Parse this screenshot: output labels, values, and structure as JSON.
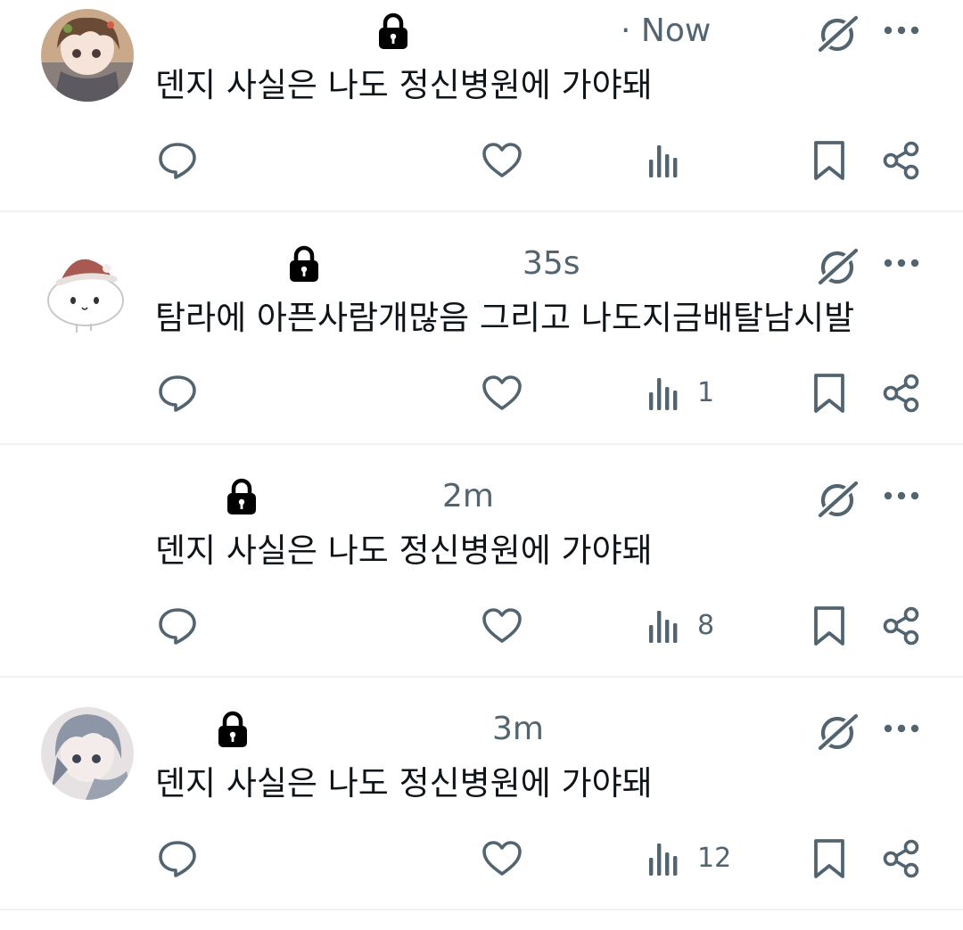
{
  "colors": {
    "text": "#0f1419",
    "secondary": "#536471",
    "divider": "#eff3f4"
  },
  "tweets": [
    {
      "has_avatar": true,
      "avatar_style": "brown-hair",
      "timestamp": "· Now",
      "text": "덴지 사실은 나도 정신병원에 가야돼",
      "view_count": ""
    },
    {
      "has_avatar": true,
      "avatar_style": "white-blob-santa-hat",
      "timestamp": "35s",
      "text": "탐라에 아픈사람개많음 그리고 나도지금배탈남시발",
      "view_count": "1"
    },
    {
      "has_avatar": false,
      "timestamp": "2m",
      "text": "덴지 사실은 나도 정신병원에 가야돼",
      "view_count": "8"
    },
    {
      "has_avatar": true,
      "avatar_style": "grey-hair",
      "timestamp": "3m",
      "text": "덴지 사실은 나도 정신병원에 가야돼",
      "view_count": "12"
    }
  ],
  "icons": {
    "lock": "lock-icon",
    "grok": "grok-icon",
    "more": "more-icon",
    "reply": "reply-icon",
    "like": "heart-icon",
    "views": "views-icon",
    "bookmark": "bookmark-icon",
    "share": "share-icon"
  }
}
